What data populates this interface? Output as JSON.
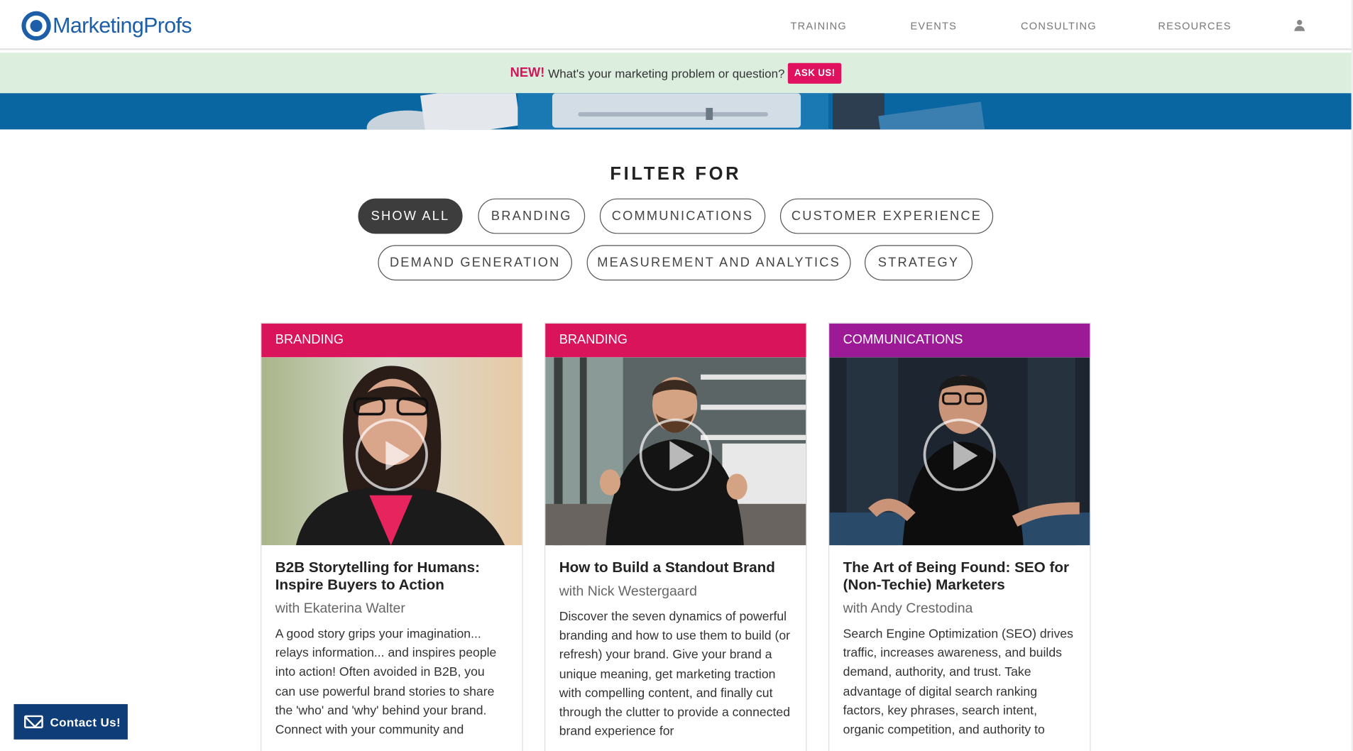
{
  "header": {
    "logo_text": "MarketingProfs",
    "nav": [
      "TRAINING",
      "EVENTS",
      "CONSULTING",
      "RESOURCES"
    ]
  },
  "promo": {
    "new_label": "NEW!",
    "text": "What's your marketing problem or question?",
    "button": "ASK US!"
  },
  "filter": {
    "title": "FILTER FOR",
    "options": [
      "SHOW ALL",
      "BRANDING",
      "COMMUNICATIONS",
      "CUSTOMER EXPERIENCE",
      "DEMAND GENERATION",
      "MEASUREMENT AND ANALYTICS",
      "STRATEGY"
    ],
    "selected": "SHOW ALL"
  },
  "cards": [
    {
      "category": "BRANDING",
      "category_color": "#d9145b",
      "title": "B2B Storytelling for Humans: Inspire Buyers to Action",
      "author": "with Ekaterina Walter",
      "description": "A good story grips your imagination... relays information... and inspires people into action! Often avoided in B2B, you can use powerful brand stories to share the 'who' and 'why' behind your brand. Connect with your community and"
    },
    {
      "category": "BRANDING",
      "category_color": "#d9145b",
      "title": "How to Build a Standout Brand",
      "author": "with Nick Westergaard",
      "description": "Discover the seven dynamics of powerful branding and how to use them to build (or refresh) your brand. Give your brand a unique meaning, get marketing traction with compelling content, and finally cut through the clutter to provide a connected brand experience for"
    },
    {
      "category": "COMMUNICATIONS",
      "category_color": "#9c1a96",
      "title": "The Art of Being Found: SEO for (Non-Techie) Marketers",
      "author": "with Andy Crestodina",
      "description": "Search Engine Optimization (SEO) drives traffic, increases awareness, and builds demand, authority, and trust. Take advantage of digital search ranking factors, key phrases, search intent, organic competition, and authority to"
    }
  ],
  "contact_button": "Contact Us!"
}
